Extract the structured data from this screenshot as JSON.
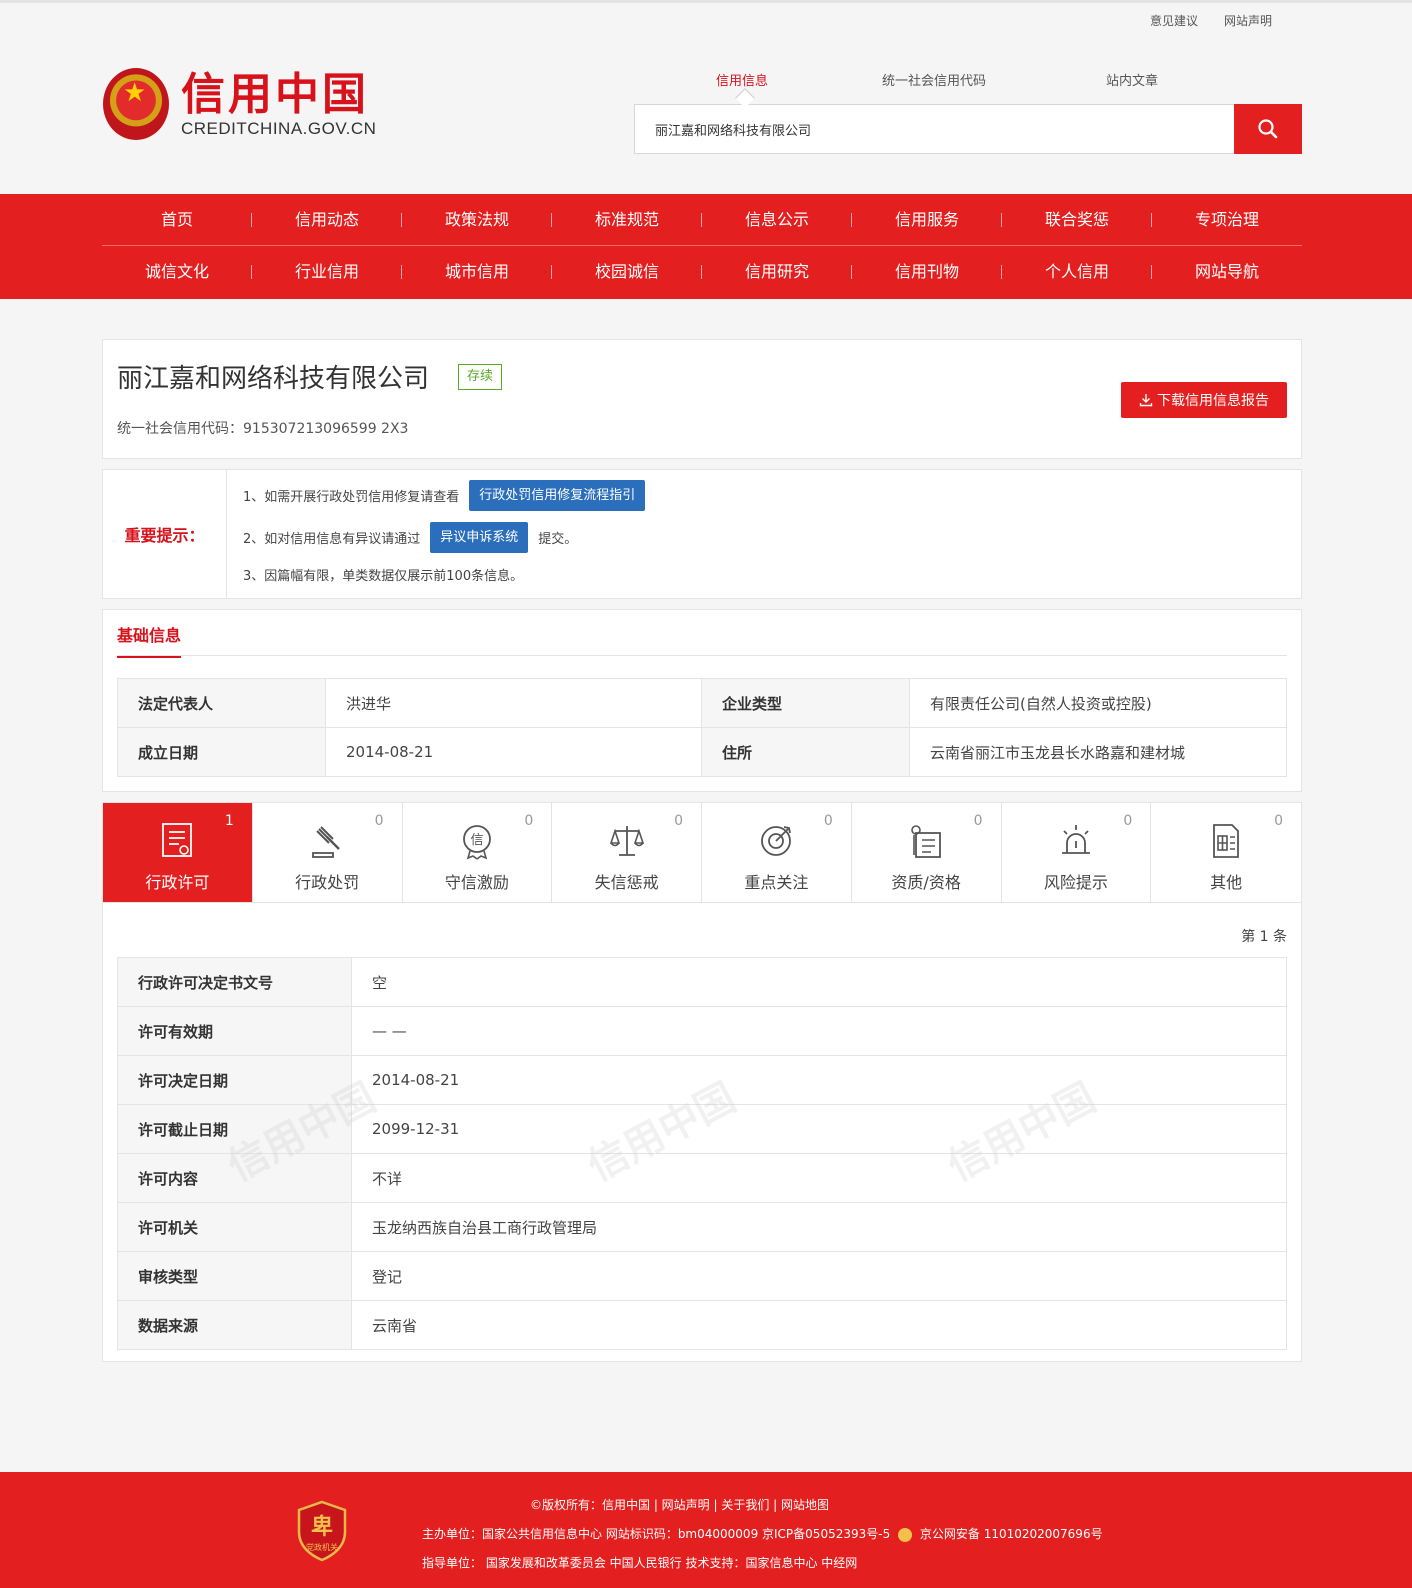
{
  "top_links": [
    "意见建议",
    "网站声明"
  ],
  "logo": {
    "cn": "信用中国",
    "en": "CREDITCHINA.GOV.CN"
  },
  "search": {
    "tabs": [
      "信用信息",
      "统一社会信用代码",
      "站内文章"
    ],
    "active_tab": "信用信息",
    "value": "丽江嘉和网络科技有限公司"
  },
  "nav": {
    "row1": [
      "首页",
      "信用动态",
      "政策法规",
      "标准规范",
      "信息公示",
      "信用服务",
      "联合奖惩",
      "专项治理"
    ],
    "row2": [
      "诚信文化",
      "行业信用",
      "城市信用",
      "校园诚信",
      "信用研究",
      "信用刊物",
      "个人信用",
      "网站导航"
    ]
  },
  "company": {
    "name": "丽江嘉和网络科技有限公司",
    "status": "存续",
    "credit_code": "统一社会信用代码：915307213096599 2X3",
    "download_label": "下载信用信息报告"
  },
  "notice": {
    "label": "重要提示：",
    "line1": "1、如需开展行政处罚信用修复请查看",
    "line1_btn": "行政处罚信用修复流程指引",
    "line2": "2、如对信用信息有异议请通过",
    "line2_btn": "异议申诉系统",
    "line2_suffix": "提交。",
    "line3": "3、因篇幅有限，单类数据仅展示前100条信息。"
  },
  "basic": {
    "title": "基础信息",
    "rows": [
      {
        "k1": "法定代表人",
        "v1": "洪进华",
        "k2": "企业类型",
        "v2": "有限责任公司(自然人投资或控股)"
      },
      {
        "k1": "成立日期",
        "v1": "2014-08-21",
        "k2": "住所",
        "v2": "云南省丽江市玉龙县长水路嘉和建材城"
      }
    ]
  },
  "tabs": [
    {
      "label": "行政许可",
      "count": "1",
      "icon": "license-doc-icon"
    },
    {
      "label": "行政处罚",
      "count": "0",
      "icon": "gavel-icon"
    },
    {
      "label": "守信激励",
      "count": "0",
      "icon": "credit-medal-icon"
    },
    {
      "label": "失信惩戒",
      "count": "0",
      "icon": "scale-icon"
    },
    {
      "label": "重点关注",
      "count": "0",
      "icon": "target-icon"
    },
    {
      "label": "资质/资格",
      "count": "0",
      "icon": "certificate-icon"
    },
    {
      "label": "风险提示",
      "count": "0",
      "icon": "alarm-light-icon"
    },
    {
      "label": "其他",
      "count": "0",
      "icon": "other-doc-icon"
    }
  ],
  "page_count": "第 1 条",
  "detail": [
    {
      "k": "行政许可决定书文号",
      "v": "空"
    },
    {
      "k": "许可有效期",
      "v": "— —"
    },
    {
      "k": "许可决定日期",
      "v": "2014-08-21"
    },
    {
      "k": "许可截止日期",
      "v": "2099-12-31"
    },
    {
      "k": "许可内容",
      "v": "不详"
    },
    {
      "k": "许可机关",
      "v": "玉龙纳西族自治县工商行政管理局"
    },
    {
      "k": "审核类型",
      "v": "登记"
    },
    {
      "k": "数据来源",
      "v": "云南省"
    }
  ],
  "watermark": "信用中国",
  "footer": {
    "line1": "©版权所有：信用中国 | 网站声明 | 关于我们 | 网站地图",
    "line2": "主办单位：国家公共信用信息中心 网站标识码：bm04000009 京ICP备05052393号-5",
    "line2b": "京公网安备 11010202007696号",
    "line3": "指导单位： 国家发展和改革委员会 中国人民银行 技术支持：国家信息中心 中经网",
    "badge_text": "党政机关"
  },
  "colors": {
    "brand_red": "#e3201f",
    "link_blue": "#2b6ebc",
    "status_green": "#5aa828"
  }
}
